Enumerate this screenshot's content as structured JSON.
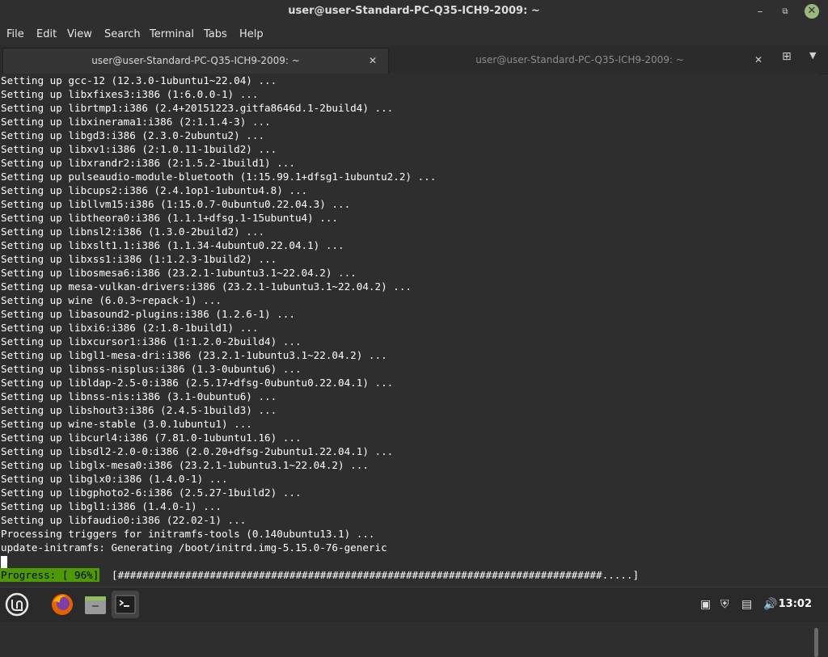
{
  "window": {
    "title": "user@user-Standard-PC-Q35-ICH9-2009: ~"
  },
  "menu": [
    "File",
    "Edit",
    "View",
    "Search",
    "Terminal",
    "Tabs",
    "Help"
  ],
  "tabs": [
    {
      "label": "user@user-Standard-PC-Q35-ICH9-2009: ~",
      "active": true
    },
    {
      "label": "user@user-Standard-PC-Q35-ICH9-2009: ~",
      "active": false
    }
  ],
  "terminal": {
    "lines": [
      "Setting up gcc-12 (12.3.0-1ubuntu1~22.04) ...",
      "Setting up libxfixes3:i386 (1:6.0.0-1) ...",
      "Setting up librtmp1:i386 (2.4+20151223.gitfa8646d.1-2build4) ...",
      "Setting up libxinerama1:i386 (2:1.1.4-3) ...",
      "Setting up libgd3:i386 (2.3.0-2ubuntu2) ...",
      "Setting up libxv1:i386 (2:1.0.11-1build2) ...",
      "Setting up libxrandr2:i386 (2:1.5.2-1build1) ...",
      "Setting up pulseaudio-module-bluetooth (1:15.99.1+dfsg1-1ubuntu2.2) ...",
      "Setting up libcups2:i386 (2.4.1op1-1ubuntu4.8) ...",
      "Setting up libllvm15:i386 (1:15.0.7-0ubuntu0.22.04.3) ...",
      "Setting up libtheora0:i386 (1.1.1+dfsg.1-15ubuntu4) ...",
      "Setting up libnsl2:i386 (1.3.0-2build2) ...",
      "Setting up libxslt1.1:i386 (1.1.34-4ubuntu0.22.04.1) ...",
      "Setting up libxss1:i386 (1:1.2.3-1build2) ...",
      "Setting up libosmesa6:i386 (23.2.1-1ubuntu3.1~22.04.2) ...",
      "Setting up mesa-vulkan-drivers:i386 (23.2.1-1ubuntu3.1~22.04.2) ...",
      "Setting up wine (6.0.3~repack-1) ...",
      "Setting up libasound2-plugins:i386 (1.2.6-1) ...",
      "Setting up libxi6:i386 (2:1.8-1build1) ...",
      "Setting up libxcursor1:i386 (1:1.2.0-2build4) ...",
      "Setting up libgl1-mesa-dri:i386 (23.2.1-1ubuntu3.1~22.04.2) ...",
      "Setting up libnss-nisplus:i386 (1.3-0ubuntu6) ...",
      "Setting up libldap-2.5-0:i386 (2.5.17+dfsg-0ubuntu0.22.04.1) ...",
      "Setting up libnss-nis:i386 (3.1-0ubuntu6) ...",
      "Setting up libshout3:i386 (2.4.5-1build3) ...",
      "Setting up wine-stable (3.0.1ubuntu1) ...",
      "Setting up libcurl4:i386 (7.81.0-1ubuntu1.16) ...",
      "Setting up libsdl2-2.0-0:i386 (2.0.20+dfsg-2ubuntu1.22.04.1) ...",
      "Setting up libglx-mesa0:i386 (23.2.1-1ubuntu3.1~22.04.2) ...",
      "Setting up libglx0:i386 (1.4.0-1) ...",
      "Setting up libgphoto2-6:i386 (2.5.27-1build2) ...",
      "Setting up libgl1:i386 (1.4.0-1) ...",
      "Setting up libfaudio0:i386 (22.02-1) ...",
      "Processing triggers for initramfs-tools (0.140ubuntu13.1) ...",
      "update-initramfs: Generating /boot/initrd.img-5.15.0-76-generic"
    ],
    "progress_label": "Progress: [ 96%]",
    "progress_bar": "[###############################################################################.....]",
    "progress_value": 0.96
  },
  "taskbar": {
    "clock": "13:02",
    "apps": [
      "mint-menu-icon",
      "firefox-icon",
      "files-icon",
      "terminal-icon"
    ]
  },
  "colors": {
    "progress_bg": "#4e9a06",
    "terminal_bg": "#2e2e2e",
    "close_btn": "#9ab87a"
  }
}
